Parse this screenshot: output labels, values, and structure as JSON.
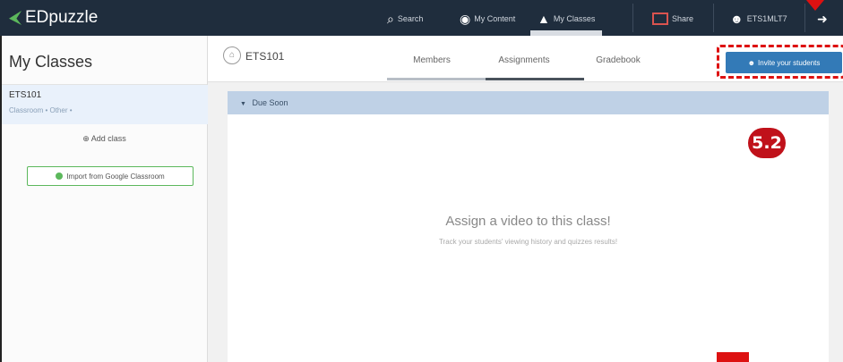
{
  "app": {
    "name": "EDpuzzle"
  },
  "nav": {
    "search": "Search",
    "my_content": "My Content",
    "my_classes": "My Classes",
    "share": "Share",
    "user": "ETS1MLT7"
  },
  "left": {
    "title": "My Classes",
    "class": {
      "name": "ETS101",
      "meta": "Classroom  •  Other  •"
    },
    "add_class": "Add class",
    "import": "Import from Google Classroom"
  },
  "header": {
    "class_name": "ETS101",
    "tabs": [
      {
        "label": "Members"
      },
      {
        "label": "Assignments"
      },
      {
        "label": "Gradebook"
      }
    ],
    "invite": "Invite your students"
  },
  "main": {
    "section": "Due Soon",
    "empty_title": "Assign a video to this class!",
    "empty_sub": "Track your students' viewing history and quizzes results!"
  },
  "annotation": {
    "step": "5.2"
  },
  "colors": {
    "navbar": "#1f2d3d",
    "accent": "#337ab7",
    "annotation": "#c0111a"
  }
}
